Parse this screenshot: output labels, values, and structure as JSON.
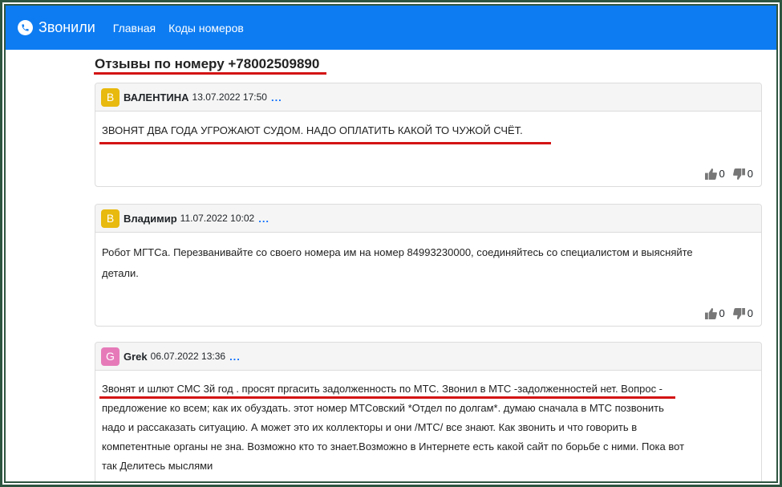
{
  "navbar": {
    "brand": "Звонили",
    "links": [
      "Главная",
      "Коды номеров"
    ]
  },
  "page": {
    "title": "Отзывы по номеру +78002509890"
  },
  "reviews": [
    {
      "avatar_letter": "B",
      "avatar_color": "#e8b90e",
      "author": "ВАЛЕНТИНА",
      "date": "13.07.2022 17:50",
      "more": "...",
      "text": "ЗВОНЯТ ДВА ГОДА УГРОЖАЮТ СУДОМ. НАДО ОПЛАТИТЬ КАКОЙ ТО ЧУЖОЙ СЧЁТ.",
      "likes": "0",
      "dislikes": "0"
    },
    {
      "avatar_letter": "B",
      "avatar_color": "#e8b90e",
      "author": "Владимир",
      "date": "11.07.2022 10:02",
      "more": "...",
      "text_lines": [
        "Робот МГТСа. Перезванивайте со своего номера им на номер 84993230000, соединяйтесь со специалистом и выясняйте",
        "детали."
      ],
      "likes": "0",
      "dislikes": "0"
    },
    {
      "avatar_letter": "G",
      "avatar_color": "#e67ab9",
      "author": "Grek",
      "date": "06.07.2022 13:36",
      "more": "...",
      "text_lines": [
        "Звонят и шлют СМС 3й год . просят пргасить задолженность по МТС. Звонил в МТС -задолженностей нет. Вопрос -",
        "предложение ко всем; как их обуздать. этот номер МТСовский *Отдел по долгам*. думаю сначала в МТС позвонить",
        "надо и рассаказать ситуацию. А может это их коллекторы и они /МТС/ все знают. Как звонить и что говорить в",
        "компетентные органы не зна. Возможно кто то знает.Возможно в Интернете есть какой сайт по борьбе с ними. Пока вот",
        "так Делитесь мыслями"
      ]
    }
  ],
  "colors": {
    "navbar": "#0d7cf2",
    "annotation_underline": "#d41414",
    "frame": "#2e5540"
  }
}
